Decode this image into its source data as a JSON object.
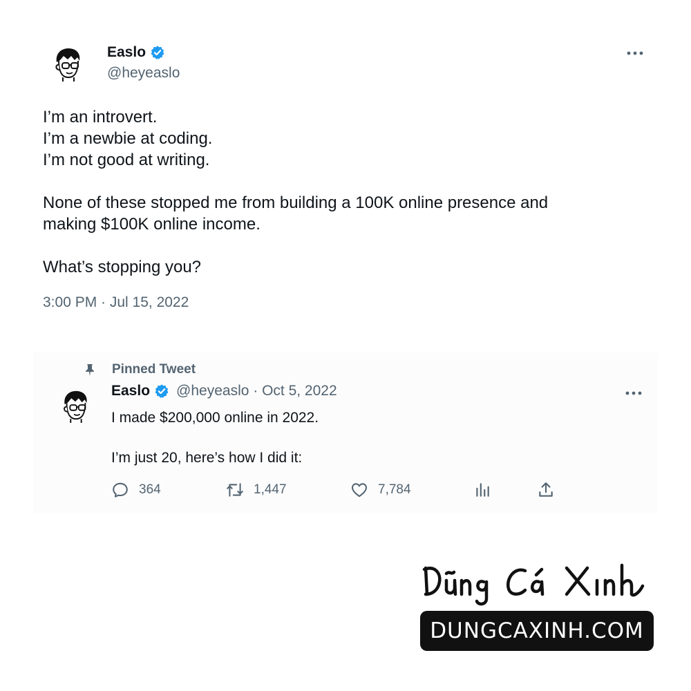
{
  "main_tweet": {
    "author": {
      "display_name": "Easlo",
      "handle": "@heyeaslo",
      "verified": true,
      "avatar_icon": "cartoon-avatar-glasses"
    },
    "more_icon": "more-horizontal-icon",
    "lines": [
      "I’m an introvert.",
      "I’m a newbie at coding.",
      "I’m not good at writing.",
      "",
      "None of these stopped me from building a 100K online presence and",
      "making $100K online income.",
      "",
      "What’s stopping you?"
    ],
    "timestamp": "3:00 PM · Jul 15, 2022"
  },
  "pinned_tweet": {
    "label": "Pinned Tweet",
    "pin_icon": "pin-icon",
    "author": {
      "display_name": "Easlo",
      "handle": "@heyeaslo",
      "verified": true
    },
    "meta": "@heyeaslo · Oct 5, 2022",
    "lines": [
      "I made $200,000 online in 2022.",
      "",
      "I’m just 20, here’s how I did it:"
    ],
    "actions": {
      "reply_count": "364",
      "retweet_count": "1,447",
      "like_count": "7,784",
      "reply_icon": "reply-icon",
      "retweet_icon": "retweet-icon",
      "like_icon": "heart-icon",
      "views_icon": "analytics-icon",
      "share_icon": "share-icon"
    }
  },
  "watermark": {
    "signature": "Dũng Cá Xinh",
    "site": "DUNGCAXINH.COM"
  },
  "colors": {
    "text_primary": "#0f1419",
    "text_secondary": "#536471",
    "verified_blue": "#1d9bf0",
    "badge_bg": "#111111"
  }
}
